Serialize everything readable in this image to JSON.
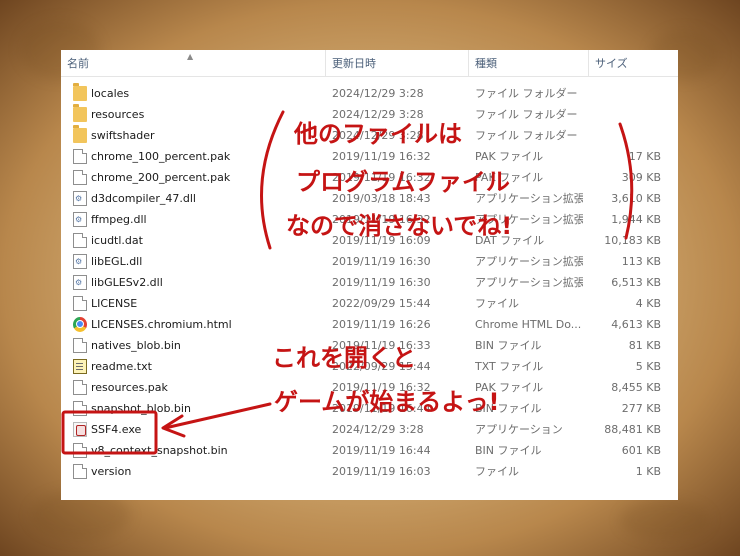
{
  "columns": {
    "name": "名前",
    "date": "更新日時",
    "type": "種類",
    "size": "サイズ"
  },
  "files": [
    {
      "icon": "folder-icon",
      "name": "locales",
      "date": "2024/12/29 3:28",
      "type": "ファイル フォルダー",
      "size": ""
    },
    {
      "icon": "folder-icon",
      "name": "resources",
      "date": "2024/12/29 3:28",
      "type": "ファイル フォルダー",
      "size": ""
    },
    {
      "icon": "folder-icon",
      "name": "swiftshader",
      "date": "2024/12/29 3:28",
      "type": "ファイル フォルダー",
      "size": ""
    },
    {
      "icon": "file-icon",
      "name": "chrome_100_percent.pak",
      "date": "2019/11/19 16:32",
      "type": "PAK ファイル",
      "size": "17 KB"
    },
    {
      "icon": "file-icon",
      "name": "chrome_200_percent.pak",
      "date": "2019/11/19 16:32",
      "type": "PAK ファイル",
      "size": "309 KB"
    },
    {
      "icon": "dll-icon",
      "name": "d3dcompiler_47.dll",
      "date": "2019/03/18 18:43",
      "type": "アプリケーション拡張",
      "size": "3,610 KB"
    },
    {
      "icon": "dll-icon",
      "name": "ffmpeg.dll",
      "date": "2019/11/19 16:32",
      "type": "アプリケーション拡張",
      "size": "1,944 KB"
    },
    {
      "icon": "file-icon",
      "name": "icudtl.dat",
      "date": "2019/11/19 16:09",
      "type": "DAT ファイル",
      "size": "10,183 KB"
    },
    {
      "icon": "dll-icon",
      "name": "libEGL.dll",
      "date": "2019/11/19 16:30",
      "type": "アプリケーション拡張",
      "size": "113 KB"
    },
    {
      "icon": "dll-icon",
      "name": "libGLESv2.dll",
      "date": "2019/11/19 16:30",
      "type": "アプリケーション拡張",
      "size": "6,513 KB"
    },
    {
      "icon": "file-icon",
      "name": "LICENSE",
      "date": "2022/09/29 15:44",
      "type": "ファイル",
      "size": "4 KB"
    },
    {
      "icon": "chrome-icon",
      "name": "LICENSES.chromium.html",
      "date": "2019/11/19 16:26",
      "type": "Chrome HTML Do...",
      "size": "4,613 KB"
    },
    {
      "icon": "file-icon",
      "name": "natives_blob.bin",
      "date": "2019/11/19 16:33",
      "type": "BIN ファイル",
      "size": "81 KB"
    },
    {
      "icon": "readme-icon",
      "name": "readme.txt",
      "date": "2022/09/29 15:44",
      "type": "TXT ファイル",
      "size": "5 KB"
    },
    {
      "icon": "file-icon",
      "name": "resources.pak",
      "date": "2019/11/19 16:32",
      "type": "PAK ファイル",
      "size": "8,455 KB"
    },
    {
      "icon": "file-icon",
      "name": "snapshot_blob.bin",
      "date": "2019/11/19 16:44",
      "type": "BIN ファイル",
      "size": "277 KB"
    },
    {
      "icon": "exe-icon",
      "name": "SSF4.exe",
      "date": "2024/12/29 3:28",
      "type": "アプリケーション",
      "size": "88,481 KB"
    },
    {
      "icon": "file-icon",
      "name": "v8_context_snapshot.bin",
      "date": "2019/11/19 16:44",
      "type": "BIN ファイル",
      "size": "601 KB"
    },
    {
      "icon": "file-icon",
      "name": "version",
      "date": "2019/11/19 16:03",
      "type": "ファイル",
      "size": "1 KB"
    }
  ],
  "annotations": {
    "note1_line1": "他のファイルは",
    "note1_line2": "プログラムファイル",
    "note1_line3": "なので消さないでね!",
    "note2_line1": "これを開くと",
    "note2_line2": "ゲームが始まるよっ!"
  },
  "colors": {
    "annotation": "#c51414",
    "folder": "#f2c55c"
  }
}
